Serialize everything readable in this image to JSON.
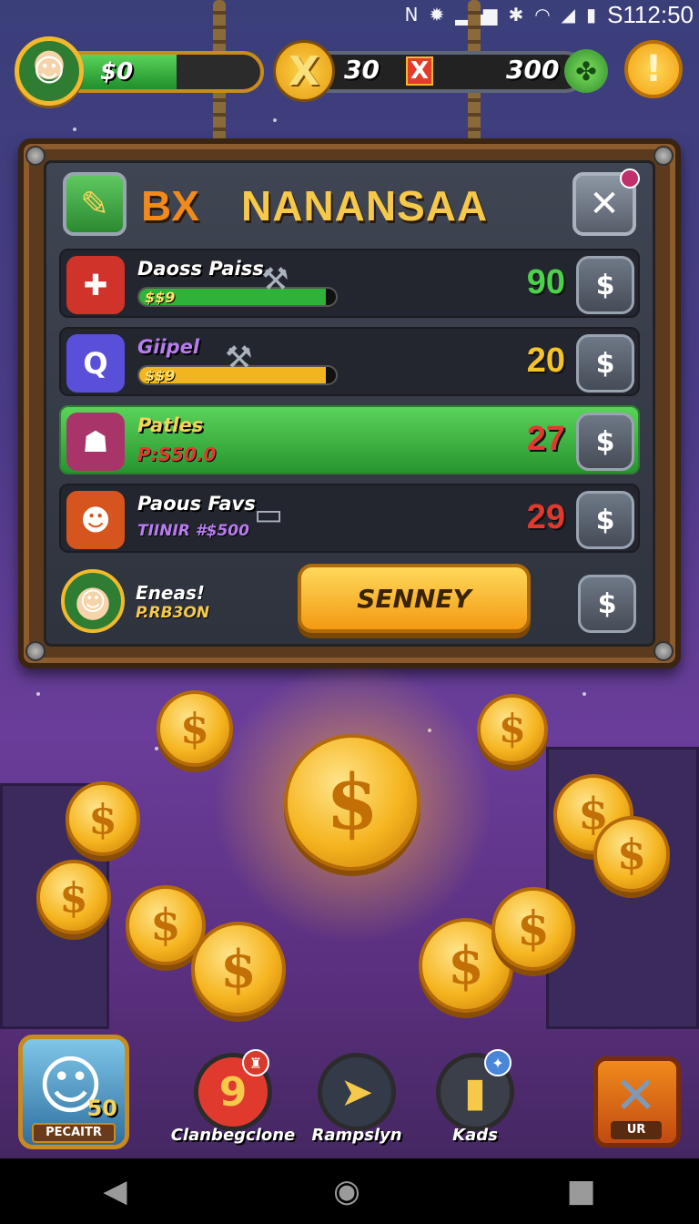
{
  "status_bar": {
    "time": "S112:50",
    "icons": [
      "nfc-icon",
      "settings-icon",
      "signal-icon",
      "bluetooth-icon",
      "wifi-icon",
      "signal-strength-icon",
      "battery-icon"
    ]
  },
  "hud": {
    "cash": "$0",
    "cash_fill_fraction": 0.55,
    "resource_left": "30",
    "resource_mid_symbol": "X",
    "resource_right": "300",
    "x_token_symbol": "X",
    "gold_button_symbol": "!"
  },
  "panel": {
    "header_prefix": "BX",
    "title": "NANANSAA",
    "close_symbol": "✕",
    "rows": [
      {
        "name": "Daoss Paiss",
        "bar_text": "$$9",
        "bar_fill_fraction": 0.95,
        "bar_color": "#2fb23a",
        "value": "90",
        "value_color": "#4ad34a",
        "button_symbol": "$",
        "icon_bg": "#d0332a",
        "icon_glyph": "✚"
      },
      {
        "name": "Giipel",
        "bar_text": "$$9",
        "bar_fill_fraction": 0.95,
        "bar_color": "#f2b51f",
        "value": "20",
        "value_color": "#f5c22a",
        "button_symbol": "$",
        "icon_bg": "#5a4fd8",
        "icon_glyph": "Q"
      },
      {
        "name": "Patles",
        "sub_text": "P:S50.0",
        "value": "27",
        "value_color": "#e03a2e",
        "button_symbol": "$",
        "icon_bg": "#a9346a",
        "icon_glyph": "☗"
      },
      {
        "name": "Paous Favs",
        "sub_text": "TIINIR #$500",
        "value": "29",
        "value_color": "#e03a2e",
        "button_symbol": "$",
        "icon_bg": "#d6541e",
        "icon_glyph": "☻"
      }
    ],
    "footer": {
      "name": "Eneas!",
      "sub_text": "P.RB3ON",
      "main_button": "SENNEY",
      "button_symbol": "$"
    }
  },
  "coins": {
    "symbol": "$"
  },
  "bottom_nav": {
    "profile": {
      "level": "50",
      "label": "PECAITR"
    },
    "items": [
      {
        "label": "Clanbegclone",
        "glyph": "9",
        "color": "#e03a2e"
      },
      {
        "label": "Rampslyn",
        "glyph": "➤",
        "color": "#333a48"
      },
      {
        "label": "Kads",
        "glyph": "▮",
        "color": "#3b3f4a"
      }
    ],
    "close_label": "UR"
  },
  "system_nav": {
    "back": "◀",
    "home": "◉",
    "recents": "■"
  }
}
